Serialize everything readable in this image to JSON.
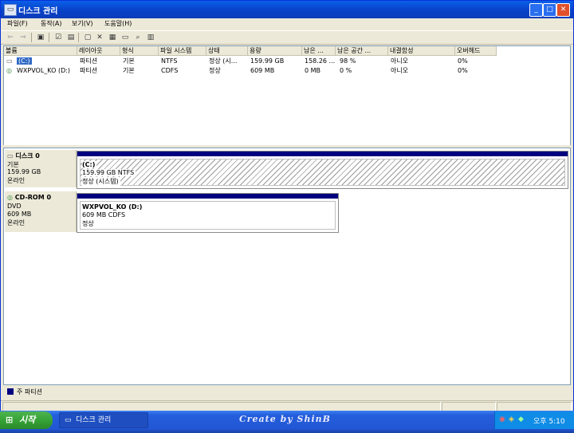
{
  "window": {
    "title": "디스크 관리",
    "icons": {
      "app": "disk-management-icon",
      "minimize": "minimize-icon",
      "maximize": "maximize-icon",
      "close": "close-icon"
    }
  },
  "menu": [
    {
      "label": "파일(F)"
    },
    {
      "label": "동작(A)"
    },
    {
      "label": "보기(V)"
    },
    {
      "label": "도움말(H)"
    }
  ],
  "toolbar": {
    "icons": [
      "back-icon",
      "forward-icon",
      "up-icon",
      "console-icon",
      "properties-icon",
      "delete-icon",
      "properties-sheet-icon",
      "open-icon",
      "search-icon",
      "help-icon"
    ]
  },
  "volume_list": {
    "columns": [
      "볼륨",
      "레이아웃",
      "형식",
      "파일 시스템",
      "상태",
      "용량",
      "남은 ...",
      "남은 공간 ...",
      "내결함성",
      "오버헤드"
    ],
    "rows": [
      {
        "volume": "(C:)",
        "layout": "파티션",
        "type": "기본",
        "fs": "NTFS",
        "status": "정상 (시...",
        "capacity": "159.99 GB",
        "free": "158.26 ...",
        "free_pct": "98 %",
        "fault": "아니오",
        "overhead": "0%"
      },
      {
        "volume": "WXPVOL_KO (D:)",
        "layout": "파티션",
        "type": "기본",
        "fs": "CDFS",
        "status": "정상",
        "capacity": "609 MB",
        "free": "0 MB",
        "free_pct": "0 %",
        "fault": "아니오",
        "overhead": "0%"
      }
    ]
  },
  "disks": [
    {
      "name": "디스크 0",
      "kind": "기본",
      "size": "159.99 GB",
      "state": "온라인",
      "partition": {
        "title": "(C:)",
        "detail": "159.99 GB NTFS",
        "status": "정상 (시스템)"
      }
    },
    {
      "name": "CD-ROM 0",
      "kind": "DVD",
      "size": "609 MB",
      "state": "온라인",
      "partition": {
        "title": "WXPVOL_KO  (D:)",
        "detail": "609 MB CDFS",
        "status": "정상"
      }
    }
  ],
  "legend": {
    "label": "주 파티션",
    "color": "#00007f"
  },
  "taskbar": {
    "start_label": "시작",
    "task_label": "디스크 관리",
    "brand": "Create by ShinB",
    "clock": "오후 5:10"
  }
}
